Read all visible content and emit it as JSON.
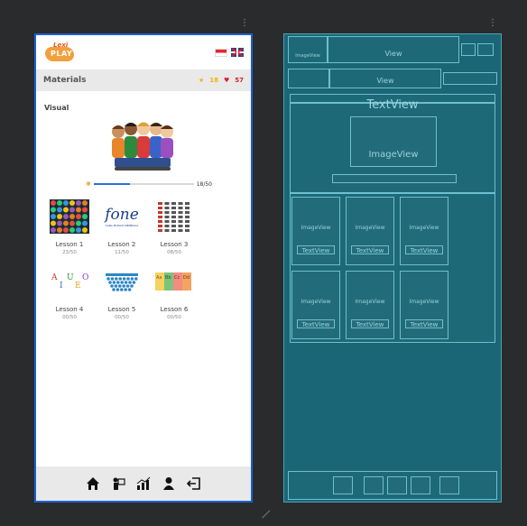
{
  "app": {
    "logo_top": "Lexi",
    "logo_bottom": "PLAY",
    "title": "Materials",
    "stars": "18",
    "hearts": "57",
    "section": "Visual",
    "progress_text": "18/50",
    "progress_fraction": 0.36
  },
  "lessons": [
    {
      "name": "Lesson 1",
      "progress": "23/50"
    },
    {
      "name": "Lesson 2",
      "progress": "11/50"
    },
    {
      "name": "Lesson 3",
      "progress": "08/50"
    },
    {
      "name": "Lesson 4",
      "progress": "00/50"
    },
    {
      "name": "Lesson 5",
      "progress": "00/50"
    },
    {
      "name": "Lesson 6",
      "progress": "00/50"
    }
  ],
  "thumb_text": {
    "lesson2_big": "fone",
    "lesson2_small": "CARA MUDAH MEMBACA",
    "lesson4_letters": "A I U E O"
  },
  "nav": [
    {
      "icon": "home-icon"
    },
    {
      "icon": "presentation-icon"
    },
    {
      "icon": "chart-icon"
    },
    {
      "icon": "profile-icon"
    },
    {
      "icon": "logout-icon"
    }
  ],
  "blueprint": {
    "imageview": "ImageView",
    "view": "View",
    "textview": "TextView",
    "imageview_big": "ImageView"
  },
  "colors": {
    "accent": "#f2a03d",
    "heart": "#d1242c",
    "blueprint_bg": "#1a6676",
    "progress": "#2e6fd6"
  }
}
